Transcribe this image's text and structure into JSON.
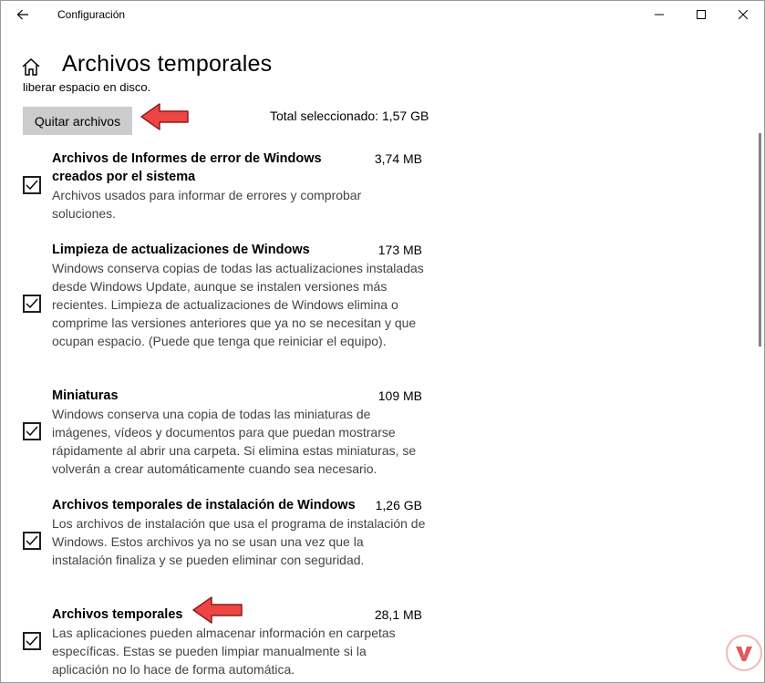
{
  "window": {
    "title": "Configuración"
  },
  "header": {
    "title": "Archivos temporales",
    "clipped_text": "liberar espacio en disco."
  },
  "actions": {
    "remove_button": "Quitar archivos",
    "total_selected": "Total seleccionado: 1,57 GB"
  },
  "items": [
    {
      "title": "Archivos de Informes de error de Windows creados por el sistema",
      "size": "3,74 MB",
      "description": "Archivos usados para informar de errores y comprobar soluciones.",
      "checked": true
    },
    {
      "title": "Limpieza de actualizaciones de Windows",
      "size": "173 MB",
      "description": "Windows conserva copias de todas las actualizaciones instaladas desde Windows Update, aunque se instalen versiones más recientes. Limpieza de actualizaciones de Windows elimina o comprime las versiones anteriores que ya no se necesitan y que ocupan espacio. (Puede que tenga que reiniciar el equipo).",
      "checked": true
    },
    {
      "title": "Miniaturas",
      "size": "109 MB",
      "description": "Windows conserva una copia de todas las miniaturas de imágenes, vídeos y documentos para que puedan mostrarse rápidamente al abrir una carpeta. Si elimina estas miniaturas, se volverán a crear automáticamente cuando sea necesario.",
      "checked": true
    },
    {
      "title": "Archivos temporales de instalación de Windows",
      "size": "1,26 GB",
      "description": "Los archivos de instalación que usa el programa de instalación de Windows. Estos archivos ya no se usan una vez que la instalación finaliza y se pueden eliminar con seguridad.",
      "checked": true
    },
    {
      "title": "Archivos temporales",
      "size": "28,1 MB",
      "description": "Las aplicaciones pueden almacenar información en carpetas específicas. Estas se pueden limpiar manualmente si la aplicación no lo hace de forma automática.",
      "checked": true
    }
  ],
  "icons": {
    "back": "back-arrow-icon",
    "minimize": "minimize-icon",
    "maximize": "maximize-icon",
    "close": "close-icon",
    "home": "home-icon",
    "check": "checkmark-icon",
    "annotation": "red-arrow-icon",
    "watermark": "watermark-logo-icon"
  },
  "colors": {
    "button_bg": "#cccccc",
    "description_text": "#444444",
    "annotation_arrow": "#ee4444",
    "scrollbar": "#858585"
  }
}
